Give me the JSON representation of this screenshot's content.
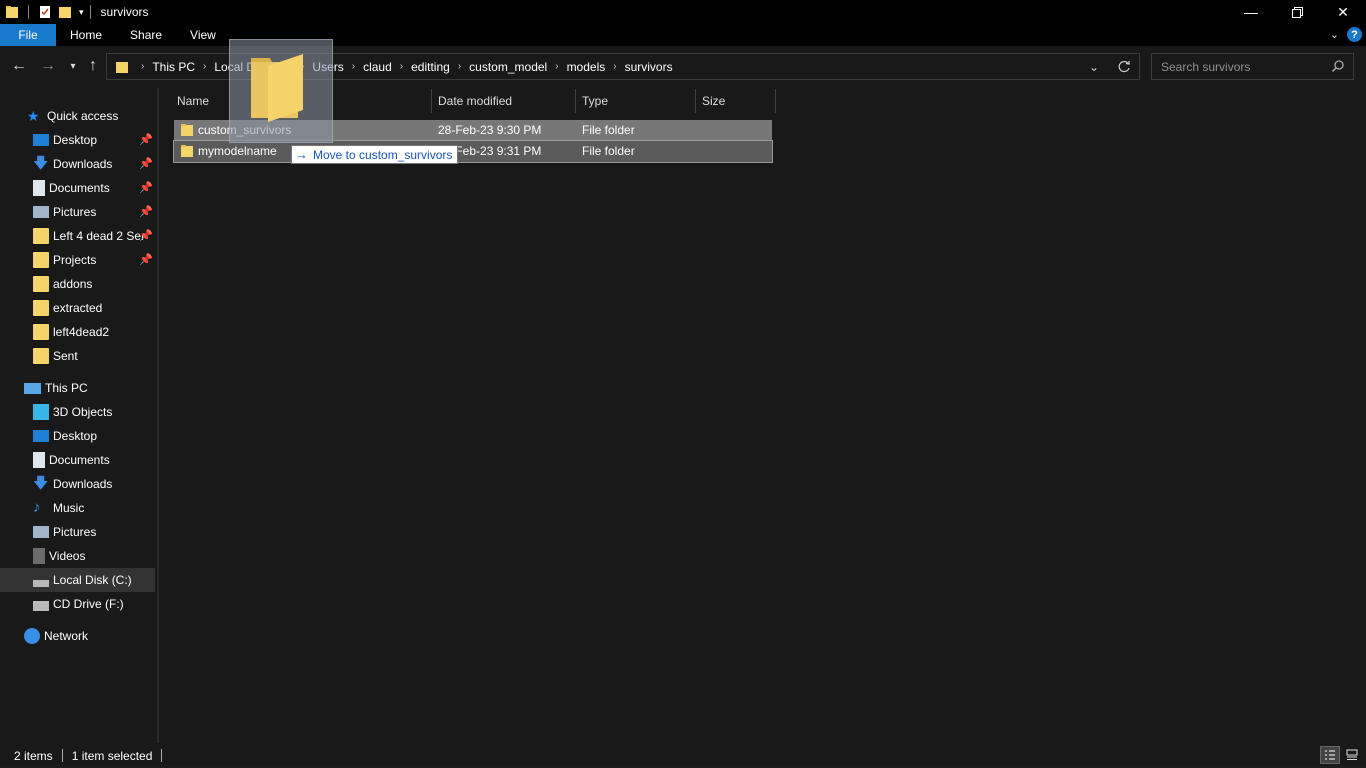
{
  "window": {
    "title": "survivors"
  },
  "ribbon": {
    "tabs": [
      "File",
      "Home",
      "Share",
      "View"
    ]
  },
  "address": {
    "crumbs": [
      "This PC",
      "Local Disk (C:)",
      "Users",
      "claud",
      "editting",
      "custom_model",
      "models",
      "survivors"
    ]
  },
  "search": {
    "placeholder": "Search survivors"
  },
  "sidebar": {
    "quick_access": "Quick access",
    "quick_items": [
      "Desktop",
      "Downloads",
      "Documents",
      "Pictures",
      "Left 4 dead 2 Ser",
      "Projects",
      "addons",
      "extracted",
      "left4dead2",
      "Sent"
    ],
    "this_pc": "This PC",
    "pc_items": [
      "3D Objects",
      "Desktop",
      "Documents",
      "Downloads",
      "Music",
      "Pictures",
      "Videos",
      "Local Disk (C:)",
      "CD Drive (F:)"
    ],
    "network": "Network"
  },
  "columns": {
    "name": "Name",
    "date": "Date modified",
    "type": "Type",
    "size": "Size"
  },
  "files": [
    {
      "name": "custom_survivors",
      "date": "28-Feb-23 9:30 PM",
      "type": "File folder",
      "size": ""
    },
    {
      "name": "mymodelname",
      "date": "28-Feb-23 9:31 PM",
      "type": "File folder",
      "size": ""
    }
  ],
  "drag": {
    "tooltip": "Move to custom_survivors"
  },
  "status": {
    "count": "2 items",
    "selected": "1 item selected"
  },
  "colors": {
    "accent": "#1979ca",
    "folder": "#f7d46a",
    "background": "#191919"
  }
}
